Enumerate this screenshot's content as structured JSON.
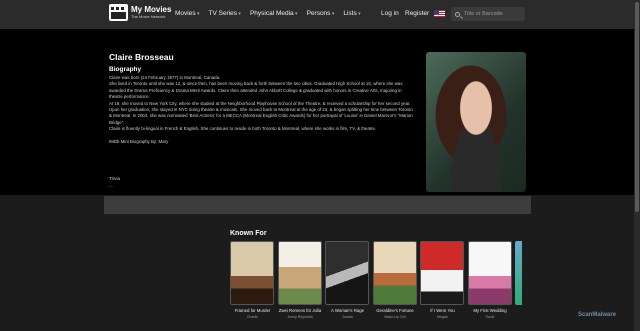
{
  "header": {
    "logo_title": "My Movies",
    "logo_subtitle": "The Movie Network",
    "nav": [
      "Movies",
      "TV Series",
      "Physical Media",
      "Persons",
      "Lists"
    ],
    "login": "Log in",
    "register": "Register",
    "search_placeholder": "Title or Barcode"
  },
  "person": {
    "name": "Claire Brosseau",
    "bio_heading": "Biography",
    "bio": [
      "Claire was born (24 February 1977) in Montreal, Canada.",
      "She lived in Toronto until she was 12, & since then, has been moving back & forth between the two cities. Graduated High School at 16, where she was awarded the Drama Proficiency & Drama Merit Awards. Claire then attended John Abbott College & graduated with honors in Creative Arts, majoring in theatre performance.",
      "At 19, she moved to New York City, where she studied at the Neighborhood Playhouse School of the Theatre, & received a scholarship for her second year. Upon her graduation, she stayed in NYC doing theatre & musicals. She moved back to Montreal at the age of 23, & began splitting her time between Toronto & Montreal. In 2003, she was nominated 'Best Actress' for a MECCA (Montreal English Critic Awards) for her portrayal of 'Louise' in Daniel MacIvor's \"Marion Bridge\".",
      "Claire is fluently bi-lingual in French & English. She continues to reside in both Toronto & Montreal, where she works in film, TV, & theatre."
    ],
    "bio_credit": "IMDb Mini Biography By: Mary",
    "trivia_label": "Trivia",
    "trivia_more": "..."
  },
  "known_for": {
    "heading": "Known For",
    "items": [
      {
        "title": "Framed for Murder",
        "role": "Charlie"
      },
      {
        "title": "Zwei Romeos für Julia",
        "role": "Jenny Reynolds"
      },
      {
        "title": "A Woman's Rage",
        "role": "Jordan"
      },
      {
        "title": "Geraldine's Fortune",
        "role": "Make-Up Girl"
      },
      {
        "title": "If I Were You",
        "role": "Megan"
      },
      {
        "title": "My First Wedding",
        "role": "Suzie"
      }
    ]
  },
  "watermark": "ScanMalware"
}
